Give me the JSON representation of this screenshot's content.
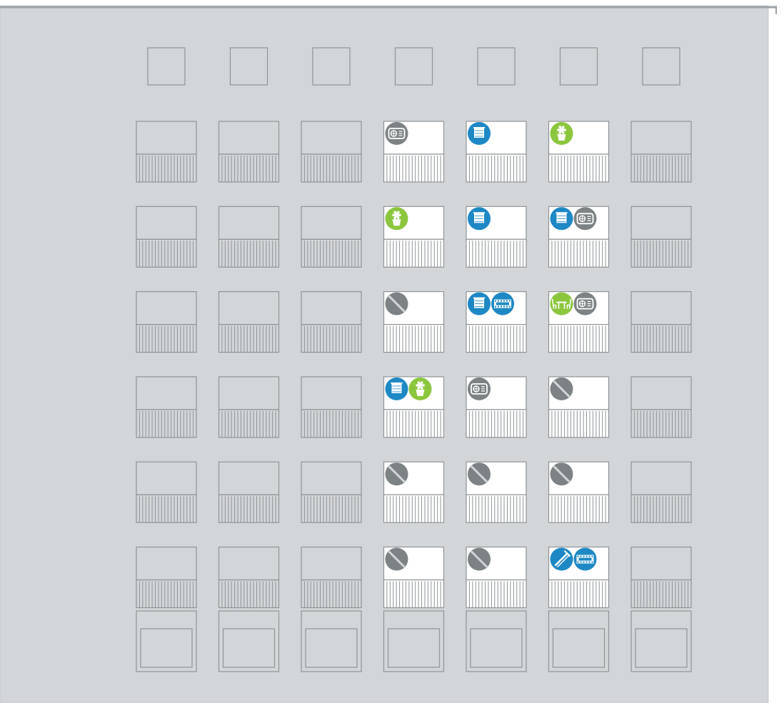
{
  "colors": {
    "facade": "#d3d6d8",
    "facade_edge": "#c7cacc",
    "roof_line": "#9ea3a6",
    "outline": "#8f9497",
    "lit_window": "#ffffff",
    "slat": "#8f9497",
    "blue_icon": "#1e88c4",
    "green_icon": "#8cc63e",
    "gray_icon": "#7d8385",
    "icon_glyph": "#ffffff"
  },
  "building": {
    "columns": 7,
    "floors": 6,
    "top_vents": 7,
    "ground_doors": 7
  },
  "icon_legend": {
    "radiator": "gray",
    "window-blind": "blue",
    "plant": "green",
    "no-occupancy": "gray",
    "table-chairs": "green",
    "film-strip": "blue",
    "tools": "blue"
  },
  "apartments": [
    {
      "floor": 1,
      "column": 4,
      "lit": true,
      "icons": [
        "radiator"
      ]
    },
    {
      "floor": 1,
      "column": 5,
      "lit": true,
      "icons": [
        "window-blind"
      ]
    },
    {
      "floor": 1,
      "column": 6,
      "lit": true,
      "icons": [
        "plant"
      ]
    },
    {
      "floor": 2,
      "column": 4,
      "lit": true,
      "icons": [
        "plant"
      ]
    },
    {
      "floor": 2,
      "column": 5,
      "lit": true,
      "icons": [
        "window-blind"
      ]
    },
    {
      "floor": 2,
      "column": 6,
      "lit": true,
      "icons": [
        "window-blind",
        "radiator"
      ]
    },
    {
      "floor": 3,
      "column": 4,
      "lit": true,
      "icons": [
        "no-occupancy"
      ]
    },
    {
      "floor": 3,
      "column": 5,
      "lit": true,
      "icons": [
        "window-blind",
        "film-strip"
      ]
    },
    {
      "floor": 3,
      "column": 6,
      "lit": true,
      "icons": [
        "table-chairs",
        "radiator"
      ]
    },
    {
      "floor": 4,
      "column": 4,
      "lit": true,
      "icons": [
        "window-blind",
        "plant"
      ]
    },
    {
      "floor": 4,
      "column": 5,
      "lit": true,
      "icons": [
        "radiator"
      ]
    },
    {
      "floor": 4,
      "column": 6,
      "lit": true,
      "icons": [
        "no-occupancy"
      ]
    },
    {
      "floor": 5,
      "column": 4,
      "lit": true,
      "icons": [
        "no-occupancy"
      ]
    },
    {
      "floor": 5,
      "column": 5,
      "lit": true,
      "icons": [
        "no-occupancy"
      ]
    },
    {
      "floor": 5,
      "column": 6,
      "lit": true,
      "icons": [
        "no-occupancy"
      ]
    },
    {
      "floor": 6,
      "column": 4,
      "lit": true,
      "icons": [
        "no-occupancy"
      ]
    },
    {
      "floor": 6,
      "column": 5,
      "lit": true,
      "icons": [
        "no-occupancy"
      ]
    },
    {
      "floor": 6,
      "column": 6,
      "lit": true,
      "icons": [
        "tools",
        "film-strip"
      ]
    }
  ]
}
